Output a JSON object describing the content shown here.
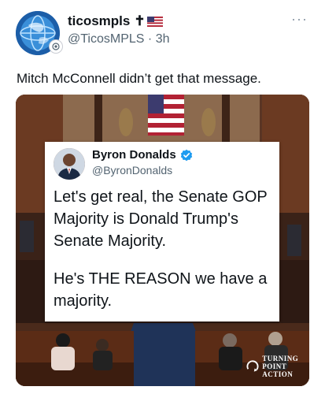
{
  "author": {
    "display_name": "ticosmpls",
    "name_decoration": "✝",
    "flag_icon": "us-flag-icon",
    "handle": "@TicosMPLS",
    "separator": "·",
    "time_ago": "3h"
  },
  "menu": {
    "more_label": "···"
  },
  "tweet": {
    "text": "Mitch McConnell didn’t get that message."
  },
  "quoted": {
    "name": "Byron Donalds",
    "handle": "@ByronDonalds",
    "verified_icon": "verified-badge-icon",
    "body_paragraph_1": "Let's get real, the Senate GOP Majority is Donald Trump's Senate Majority.",
    "body_paragraph_2": "He's THE REASON we have a majority."
  },
  "watermark": {
    "line1": "TURNING",
    "line2": "POINT ACTION"
  },
  "colors": {
    "accent_blue": "#1d9bf0",
    "text_primary": "#0f1419",
    "text_secondary": "#536471",
    "chamber_wood": "#6b3a22",
    "flag_red": "#b22234"
  }
}
